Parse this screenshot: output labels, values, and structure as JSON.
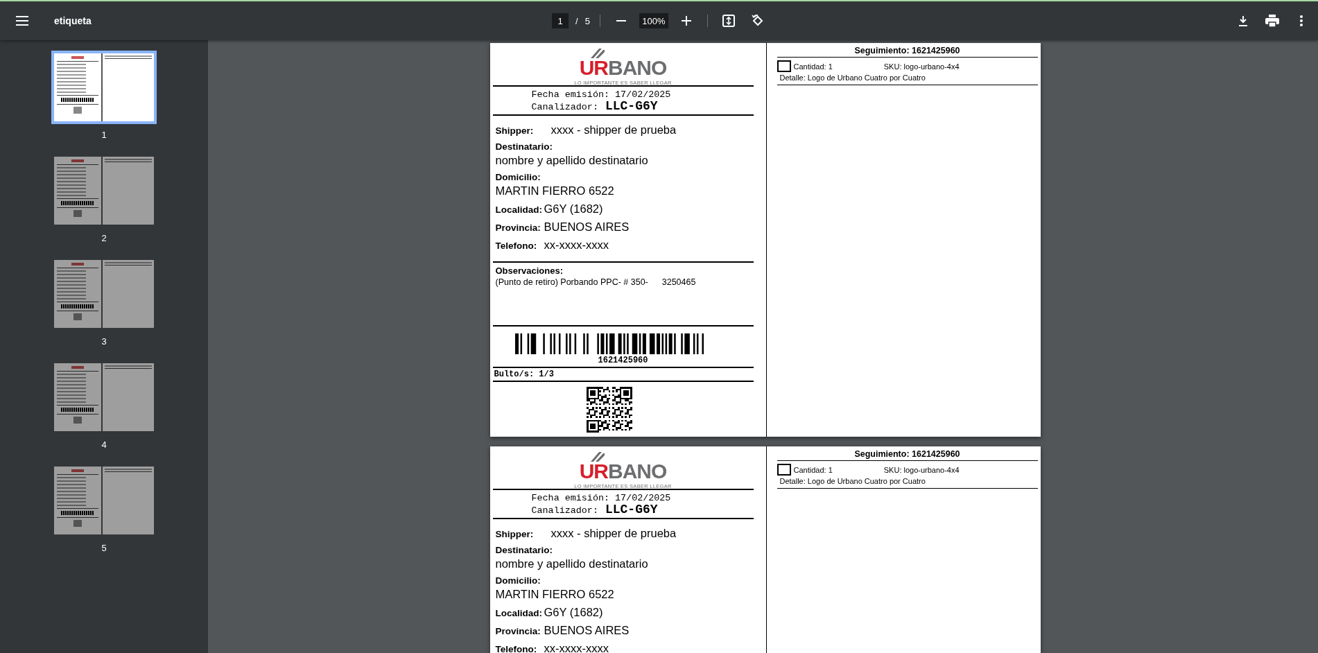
{
  "toolbar": {
    "title": "etiqueta",
    "page": "1",
    "page_separator": "/",
    "page_count": "5",
    "zoom": "100%"
  },
  "thumbnails": [
    {
      "label": "1",
      "selected": true
    },
    {
      "label": "2",
      "selected": false
    },
    {
      "label": "3",
      "selected": false
    },
    {
      "label": "4",
      "selected": false
    },
    {
      "label": "5",
      "selected": false
    }
  ],
  "pages": [
    {
      "logo": {
        "lead": "UR",
        "rest": "BANO",
        "tagline": "LO IMPORTANTE ES SABER LLEGAR"
      },
      "emission": {
        "label": "Fecha emisión:",
        "value": "17/02/2025"
      },
      "channeler": {
        "label": "Canalizador:",
        "value": "LLC-G6Y"
      },
      "fields": [
        {
          "kind": "inline",
          "label": "Shipper:",
          "value": "xxxx - shipper de prueba"
        },
        {
          "kind": "stacked",
          "label": "Destinatario:",
          "value": "nombre y apellido destinatario"
        },
        {
          "kind": "stacked",
          "label": "Domicilio:",
          "value": "MARTIN FIERRO 6522"
        },
        {
          "kind": "inline",
          "label": "Localidad:",
          "value": "G6Y (1682)"
        },
        {
          "kind": "inline",
          "label": "Provincia:",
          "value": "BUENOS AIRES"
        },
        {
          "kind": "inline",
          "label": "Telefono:",
          "value": "xx-xxxx-xxxx"
        }
      ],
      "observations": {
        "label": "Observaciones:",
        "parts": [
          "(Punto de retiro) Porbando PPC- # 350-",
          "3250465"
        ]
      },
      "barcode": {
        "number": "1621425960"
      },
      "packages": "Bulto/s: 1/3",
      "qr_code": true,
      "tracking": "Seguimiento: 1621425960",
      "items": [
        {
          "checked": false,
          "quantity": "Cantidad: 1",
          "sku": "SKU: logo-urbano-4x4",
          "detail": "Detalle: Logo de Urbano Cuatro por Cuatro"
        }
      ]
    },
    {
      "logo": {
        "lead": "UR",
        "rest": "BANO",
        "tagline": "LO IMPORTANTE ES SABER LLEGAR"
      },
      "emission": {
        "label": "Fecha emisión:",
        "value": "17/02/2025"
      },
      "channeler": {
        "label": "Canalizador:",
        "value": "LLC-G6Y"
      },
      "fields": [
        {
          "kind": "inline",
          "label": "Shipper:",
          "value": "xxxx - shipper de prueba"
        },
        {
          "kind": "stacked",
          "label": "Destinatario:",
          "value": "nombre y apellido destinatario"
        },
        {
          "kind": "stacked",
          "label": "Domicilio:",
          "value": "MARTIN FIERRO 6522"
        },
        {
          "kind": "inline",
          "label": "Localidad:",
          "value": "G6Y (1682)"
        },
        {
          "kind": "inline",
          "label": "Provincia:",
          "value": "BUENOS AIRES"
        },
        {
          "kind": "inline",
          "label": "Telefono:",
          "value": "xx-xxxx-xxxx"
        }
      ],
      "tracking": "Seguimiento: 1621425960",
      "items": [
        {
          "checked": false,
          "quantity": "Cantidad: 1",
          "sku": "SKU: logo-urbano-4x4",
          "detail": "Detalle: Logo de Urbano Cuatro por Cuatro"
        }
      ]
    }
  ]
}
